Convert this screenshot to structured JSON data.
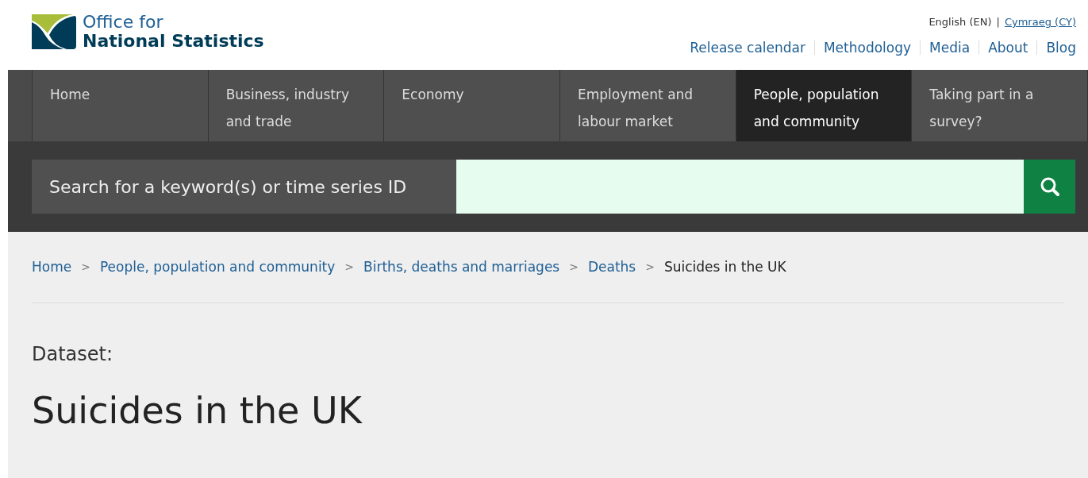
{
  "logo": {
    "line_1": "Office for",
    "line_2": "National Statistics"
  },
  "language": {
    "current": "English (EN)",
    "divider": "|",
    "other": "Cymraeg (CY)"
  },
  "top_links": [
    "Release calendar",
    "Methodology",
    "Media",
    "About",
    "Blog"
  ],
  "nav_tabs": [
    {
      "line_1": "Home",
      "selected": false
    },
    {
      "line_1": "Business, industry",
      "line_2": "and trade",
      "selected": false
    },
    {
      "line_1": "Economy",
      "selected": false
    },
    {
      "line_1": "Employment and",
      "line_2": "labour market",
      "selected": false
    },
    {
      "line_1": "People, population",
      "line_2": "and community",
      "selected": true
    },
    {
      "line_1": "Taking part in a",
      "line_2": "survey?",
      "selected": false
    }
  ],
  "search": {
    "label": "Search for a keyword(s) or time series ID"
  },
  "breadcrumbs": [
    {
      "label": "Home",
      "current": false
    },
    {
      "separator": ">",
      "label": "People, population and community",
      "current": false
    },
    {
      "separator": ">",
      "label": "Births, deaths and marriages",
      "current": false
    },
    {
      "separator": ">",
      "label": "Deaths",
      "current": false
    },
    {
      "separator": ">",
      "label": "Suicides in the UK",
      "current": true
    }
  ],
  "page": {
    "type_label": "Dataset:",
    "title": "Suicides in the UK"
  }
}
